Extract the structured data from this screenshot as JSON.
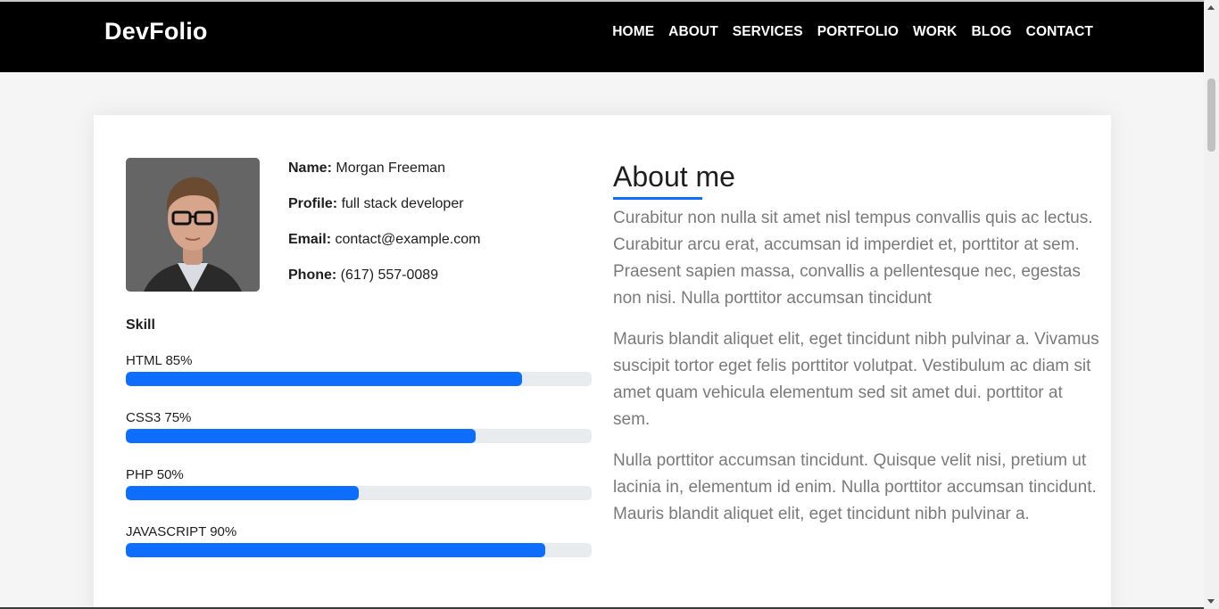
{
  "header": {
    "brand": "DevFolio",
    "nav": [
      "HOME",
      "ABOUT",
      "SERVICES",
      "PORTFOLIO",
      "WORK",
      "BLOG",
      "CONTACT"
    ]
  },
  "profile": {
    "name_label": "Name:",
    "name": "Morgan Freeman",
    "profile_label": "Profile:",
    "profile": "full stack developer",
    "email_label": "Email:",
    "email": "contact@example.com",
    "phone_label": "Phone:",
    "phone": "(617) 557-0089"
  },
  "skills": {
    "title": "Skill",
    "items": [
      {
        "label": "HTML 85%",
        "percent": 85
      },
      {
        "label": "CSS3 75%",
        "percent": 75
      },
      {
        "label": "PHP 50%",
        "percent": 50
      },
      {
        "label": "JAVASCRIPT 90%",
        "percent": 90
      }
    ]
  },
  "about": {
    "title": "About me",
    "paragraphs": [
      "Curabitur non nulla sit amet nisl tempus convallis quis ac lectus. Curabitur arcu erat, accumsan id imperdiet et, porttitor at sem. Praesent sapien massa, convallis a pellentesque nec, egestas non nisi. Nulla porttitor accumsan tincidunt",
      "Mauris blandit aliquet elit, eget tincidunt nibh pulvinar a. Vivamus suscipit tortor eget felis porttitor volutpat. Vestibulum ac diam sit amet quam vehicula elementum sed sit amet dui. porttitor at sem.",
      "Nulla porttitor accumsan tincidunt. Quisque velit nisi, pretium ut lacinia in, elementum id enim. Nulla porttitor accumsan tincidunt. Mauris blandit aliquet elit, eget tincidunt nibh pulvinar a."
    ]
  },
  "colors": {
    "navbar_bg": "#000000",
    "accent": "#0d6efd",
    "track": "#e9ecef",
    "body_text": "#7a7a7a"
  },
  "icons": {
    "avatar": "profile-photo"
  }
}
